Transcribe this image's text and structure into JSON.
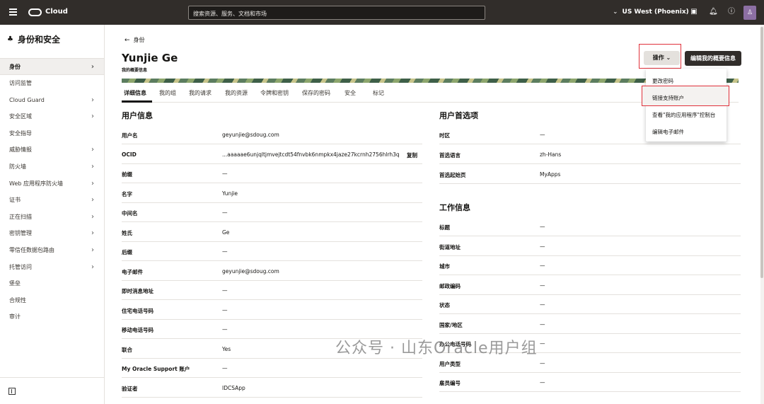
{
  "topbar": {
    "brand": "Cloud",
    "search_placeholder": "搜索资源、服务、文档和市场",
    "region": "US West (Phoenix)"
  },
  "sidebar": {
    "title": "身份和安全",
    "items": [
      {
        "label": "身份",
        "arrow": true,
        "active": true
      },
      {
        "label": "访问监管",
        "arrow": false
      },
      {
        "label": "Cloud Guard",
        "arrow": true
      },
      {
        "label": "安全区域",
        "arrow": true
      },
      {
        "label": "安全指导",
        "arrow": false
      },
      {
        "label": "威胁情报",
        "arrow": true
      },
      {
        "label": "防火墙",
        "arrow": true
      },
      {
        "label": "Web 应用程序防火墙",
        "arrow": true
      },
      {
        "label": "证书",
        "arrow": true
      },
      {
        "label": "正在扫描",
        "arrow": true
      },
      {
        "label": "密钥管理",
        "arrow": true
      },
      {
        "label": "零信任数据包路由",
        "arrow": true
      },
      {
        "label": "托管访问",
        "arrow": true
      },
      {
        "label": "堡垒",
        "arrow": false
      },
      {
        "label": "合规性",
        "arrow": false
      },
      {
        "label": "审计",
        "arrow": false
      }
    ]
  },
  "header": {
    "back_label": "身份",
    "title": "Yunjie Ge",
    "subtitle": "我的概要信息",
    "actions_label": "操作",
    "edit_label": "编辑我的概要信息"
  },
  "tabs": [
    "详细信息",
    "我的组",
    "我的请求",
    "我的资源",
    "令牌和密钥",
    "保存的密码",
    "安全",
    "标记"
  ],
  "user_info": {
    "title": "用户信息",
    "copy_label": "复制",
    "rows": [
      {
        "k": "用户名",
        "v": "geyunjie@sdoug.com"
      },
      {
        "k": "OCID",
        "v": "...aaaaae6unjqltjmvejtcdt54fnvbk6nmpkx4jaze27kcrnh2756hlrh3q"
      },
      {
        "k": "前缀",
        "v": "—"
      },
      {
        "k": "名字",
        "v": "Yunjie"
      },
      {
        "k": "中间名",
        "v": "—"
      },
      {
        "k": "姓氏",
        "v": "Ge"
      },
      {
        "k": "后缀",
        "v": "—"
      },
      {
        "k": "电子邮件",
        "v": "geyunjie@sdoug.com"
      },
      {
        "k": "即时消息地址",
        "v": "—"
      },
      {
        "k": "住宅电话号码",
        "v": "—"
      },
      {
        "k": "移动电话号码",
        "v": "—"
      },
      {
        "k": "联合",
        "v": "Yes"
      },
      {
        "k": "My Oracle Support 账户",
        "v": "—"
      },
      {
        "k": "验证者",
        "v": "IDCSApp"
      }
    ]
  },
  "prefs": {
    "title": "用户首选项",
    "rows": [
      {
        "k": "时区",
        "v": "—"
      },
      {
        "k": "首选语言",
        "v": "zh-Hans"
      },
      {
        "k": "首选起始页",
        "v": "MyApps"
      }
    ]
  },
  "work": {
    "title": "工作信息",
    "rows": [
      {
        "k": "标题",
        "v": "—"
      },
      {
        "k": "街道地址",
        "v": "—"
      },
      {
        "k": "城市",
        "v": "—"
      },
      {
        "k": "邮政编码",
        "v": "—"
      },
      {
        "k": "状态",
        "v": "—"
      },
      {
        "k": "国家/地区",
        "v": "—"
      },
      {
        "k": "办公电话号码",
        "v": "—"
      },
      {
        "k": "用户类型",
        "v": "—"
      },
      {
        "k": "雇员编号",
        "v": "—"
      }
    ]
  },
  "dropdown": [
    "更改密码",
    "链接支持账户",
    "查看\"我的应用程序\"控制台",
    "编辑电子邮件"
  ],
  "watermark": "公众号 · 山东Oracle用户组"
}
